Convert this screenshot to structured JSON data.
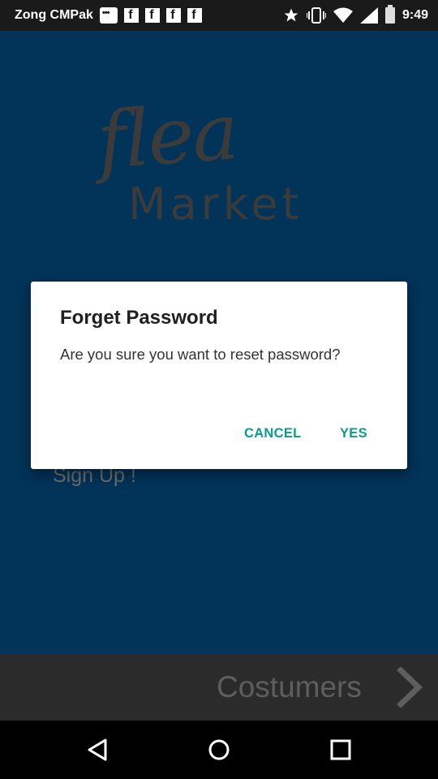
{
  "status_bar": {
    "carrier": "Zong CMPak",
    "time": "9:49",
    "icons": [
      "notification-icon",
      "facebook-icon",
      "facebook-icon",
      "facebook-icon",
      "facebook-icon",
      "star-icon",
      "vibrate-icon",
      "wifi-icon",
      "signal-icon",
      "battery-icon"
    ]
  },
  "app": {
    "logo_script": "flea",
    "logo_word": "Market",
    "signup_link": "Sign Up !"
  },
  "dialog": {
    "title": "Forget Password",
    "message": "Are you sure you want to reset password?",
    "cancel_label": "CANCEL",
    "confirm_label": "YES",
    "accent_color": "#0a9b8b"
  },
  "bottom_bar": {
    "label": "Costumers",
    "icon": "chevron-right-icon"
  },
  "nav_bar": {
    "buttons": [
      "back-icon",
      "home-icon",
      "recents-icon"
    ]
  },
  "colors": {
    "app_background": "#023359",
    "bottom_bar": "#2b2b2b"
  }
}
